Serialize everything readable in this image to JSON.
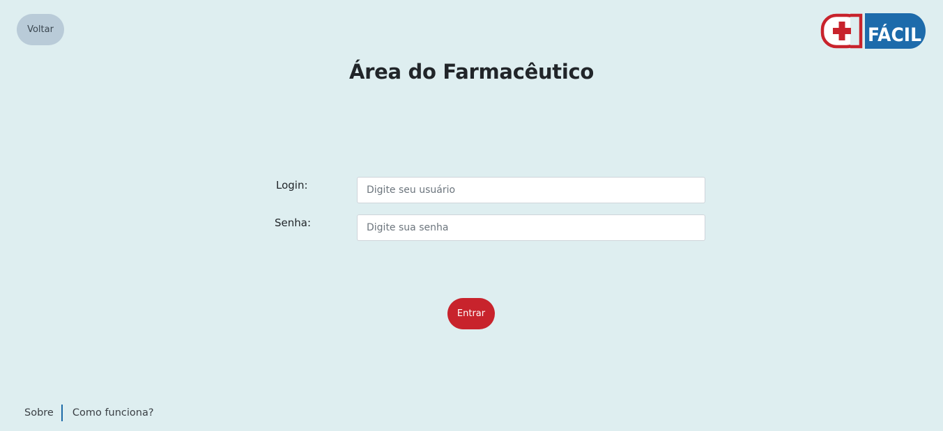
{
  "header": {
    "back_label": "Voltar",
    "logo_text": "FÁCIL"
  },
  "main": {
    "title": "Área do Farmacêutico",
    "login": {
      "label": "Login:",
      "placeholder": "Digite seu usuário",
      "value": ""
    },
    "password": {
      "label": "Senha:",
      "placeholder": "Digite sua senha",
      "value": ""
    },
    "submit_label": "Entrar"
  },
  "footer": {
    "links": [
      "Sobre",
      "Como funciona?"
    ]
  },
  "colors": {
    "background": "#deeef0",
    "back_button": "#b9cbd8",
    "submit_button": "#c8232c",
    "logo_red": "#c8232c",
    "logo_blue": "#1d6bab",
    "footer_divider": "#1c6aa8"
  },
  "icons": {
    "logo_mark": "plus-cross-icon"
  }
}
